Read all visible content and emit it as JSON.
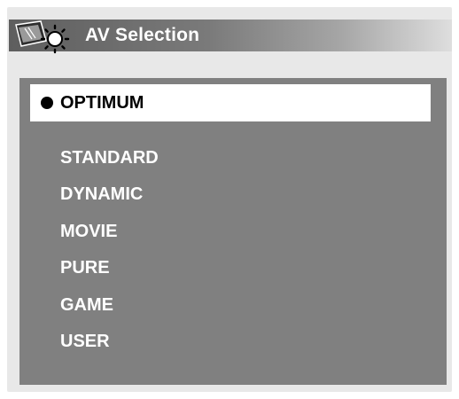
{
  "title": {
    "text": "AV Selection",
    "icon": "picture-settings-icon"
  },
  "menu": {
    "selected_index": 0,
    "items": [
      {
        "label": "OPTIMUM"
      },
      {
        "label": "STANDARD"
      },
      {
        "label": "DYNAMIC"
      },
      {
        "label": "MOVIE"
      },
      {
        "label": "PURE"
      },
      {
        "label": "GAME"
      },
      {
        "label": "USER"
      }
    ]
  }
}
